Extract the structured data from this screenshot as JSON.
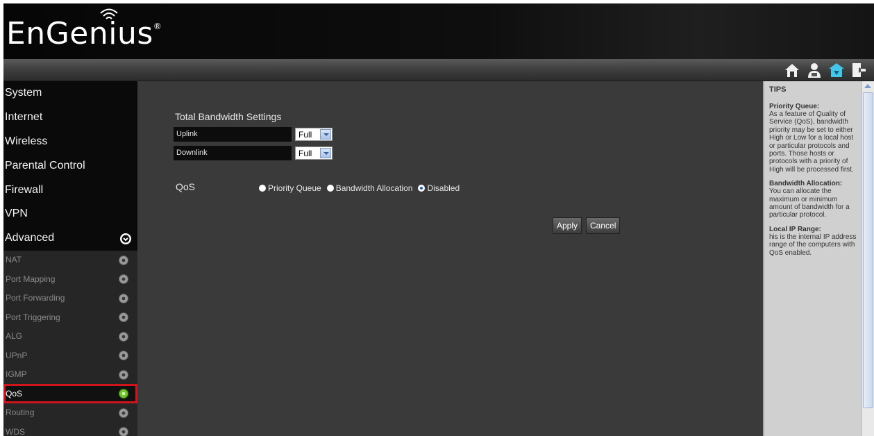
{
  "app": {
    "brand": "EnGenius",
    "brand_mark": "®"
  },
  "toolbar": {
    "icons": [
      "home-icon",
      "user-icon",
      "setup-wizard-icon",
      "logout-icon"
    ]
  },
  "sidebar": {
    "items": [
      {
        "label": "System"
      },
      {
        "label": "Internet"
      },
      {
        "label": "Wireless"
      },
      {
        "label": "Parental Control"
      },
      {
        "label": "Firewall"
      },
      {
        "label": "VPN"
      },
      {
        "label": "Advanced"
      }
    ],
    "advanced_expanded": true,
    "sub_items": [
      {
        "label": "NAT"
      },
      {
        "label": "Port Mapping"
      },
      {
        "label": "Port Forwarding"
      },
      {
        "label": "Port Triggering"
      },
      {
        "label": "ALG"
      },
      {
        "label": "UPnP"
      },
      {
        "label": "IGMP"
      },
      {
        "label": "QoS",
        "active": true
      },
      {
        "label": "Routing"
      },
      {
        "label": "WDS"
      }
    ]
  },
  "main": {
    "section_title": "Total Bandwidth Settings",
    "uplink": {
      "label": "Uplink",
      "value": "Full"
    },
    "downlink": {
      "label": "Downlink",
      "value": "Full"
    },
    "qos": {
      "label": "QoS",
      "options": [
        {
          "label": "Priority Queue",
          "checked": false
        },
        {
          "label": "Bandwidth Allocation",
          "checked": false
        },
        {
          "label": "Disabled",
          "checked": true
        }
      ]
    },
    "buttons": {
      "apply": "Apply",
      "cancel": "Cancel"
    }
  },
  "tips": {
    "title": "TIPS",
    "entries": [
      {
        "heading": "Priority Queue:",
        "body": "As a feature of Quality of Service (QoS), bandwidth priority may be set to either High or Low for a local host or particular protocols and ports. Those hosts or protocols with a priority of High will be processed first."
      },
      {
        "heading": "Bandwidth Allocation:",
        "body": "You can allocate the maximum or minimum amount of bandwidth for a particular protocol."
      },
      {
        "heading": "Local IP Range:",
        "body": "his is the internal IP address range of the computers with QoS enabled."
      }
    ]
  },
  "colors": {
    "active_highlight": "#d0141c",
    "active_dot": "#6fc22c",
    "content_bg": "#3a3a3a",
    "tips_bg": "#d0d0d0"
  }
}
